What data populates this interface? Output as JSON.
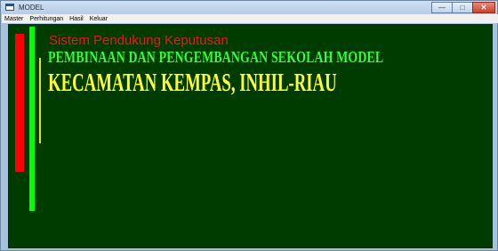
{
  "window": {
    "title": "MODEL",
    "caption_buttons": {
      "minimize": "—",
      "maximize": "□",
      "close": "✕"
    }
  },
  "menu": {
    "items": [
      {
        "label": "Master"
      },
      {
        "label": "Perhitungan"
      },
      {
        "label": "Hasil"
      },
      {
        "label": "Keluar"
      }
    ]
  },
  "content": {
    "subtitle": "Sistem Pendukung Keputusan",
    "heading": "PEMBINAAN DAN PENGEMBANGAN SEKOLAH MODEL",
    "location": "KECAMATAN KEMPAS, INHIL-RIAU"
  },
  "colors": {
    "background": "#003b00",
    "red_bar": "#ff0000",
    "green_bar": "#00ff00",
    "yellow_line": "#e9e200",
    "subtitle": "#e81b1b",
    "heading": "#33ff33",
    "location": "#ffff33"
  }
}
